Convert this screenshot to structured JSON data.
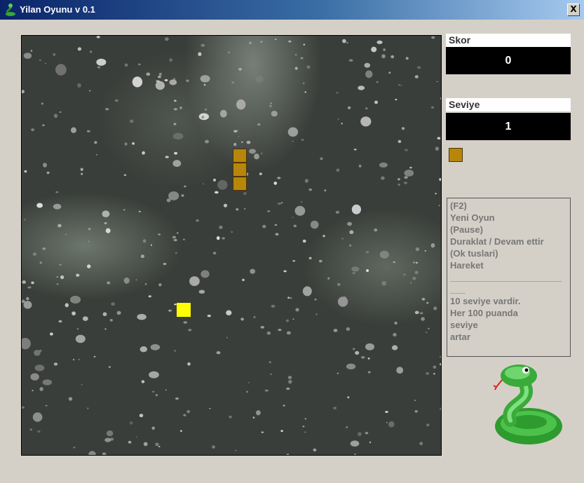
{
  "window": {
    "title": "Yilan Oyunu v 0.1",
    "close_label": "X"
  },
  "score": {
    "label": "Skor",
    "value": "0"
  },
  "level": {
    "label": "Seviye",
    "value": "1"
  },
  "help": {
    "lines": [
      "(F2)",
      "Yeni Oyun",
      "(Pause)",
      "Duraklat / Devam ettir",
      "(Ok tuslari)",
      "Hareket",
      "______________________",
      "___",
      "10 seviye vardir.",
      "Her 100 puanda",
      "seviye",
      "artar"
    ]
  },
  "colors": {
    "snake": "#b8860b",
    "food": "#ffff00",
    "title_gradient_start": "#0a246a",
    "title_gradient_end": "#a6caf0"
  },
  "icons": {
    "app": "snake-icon",
    "logo": "snake-logo-icon"
  }
}
